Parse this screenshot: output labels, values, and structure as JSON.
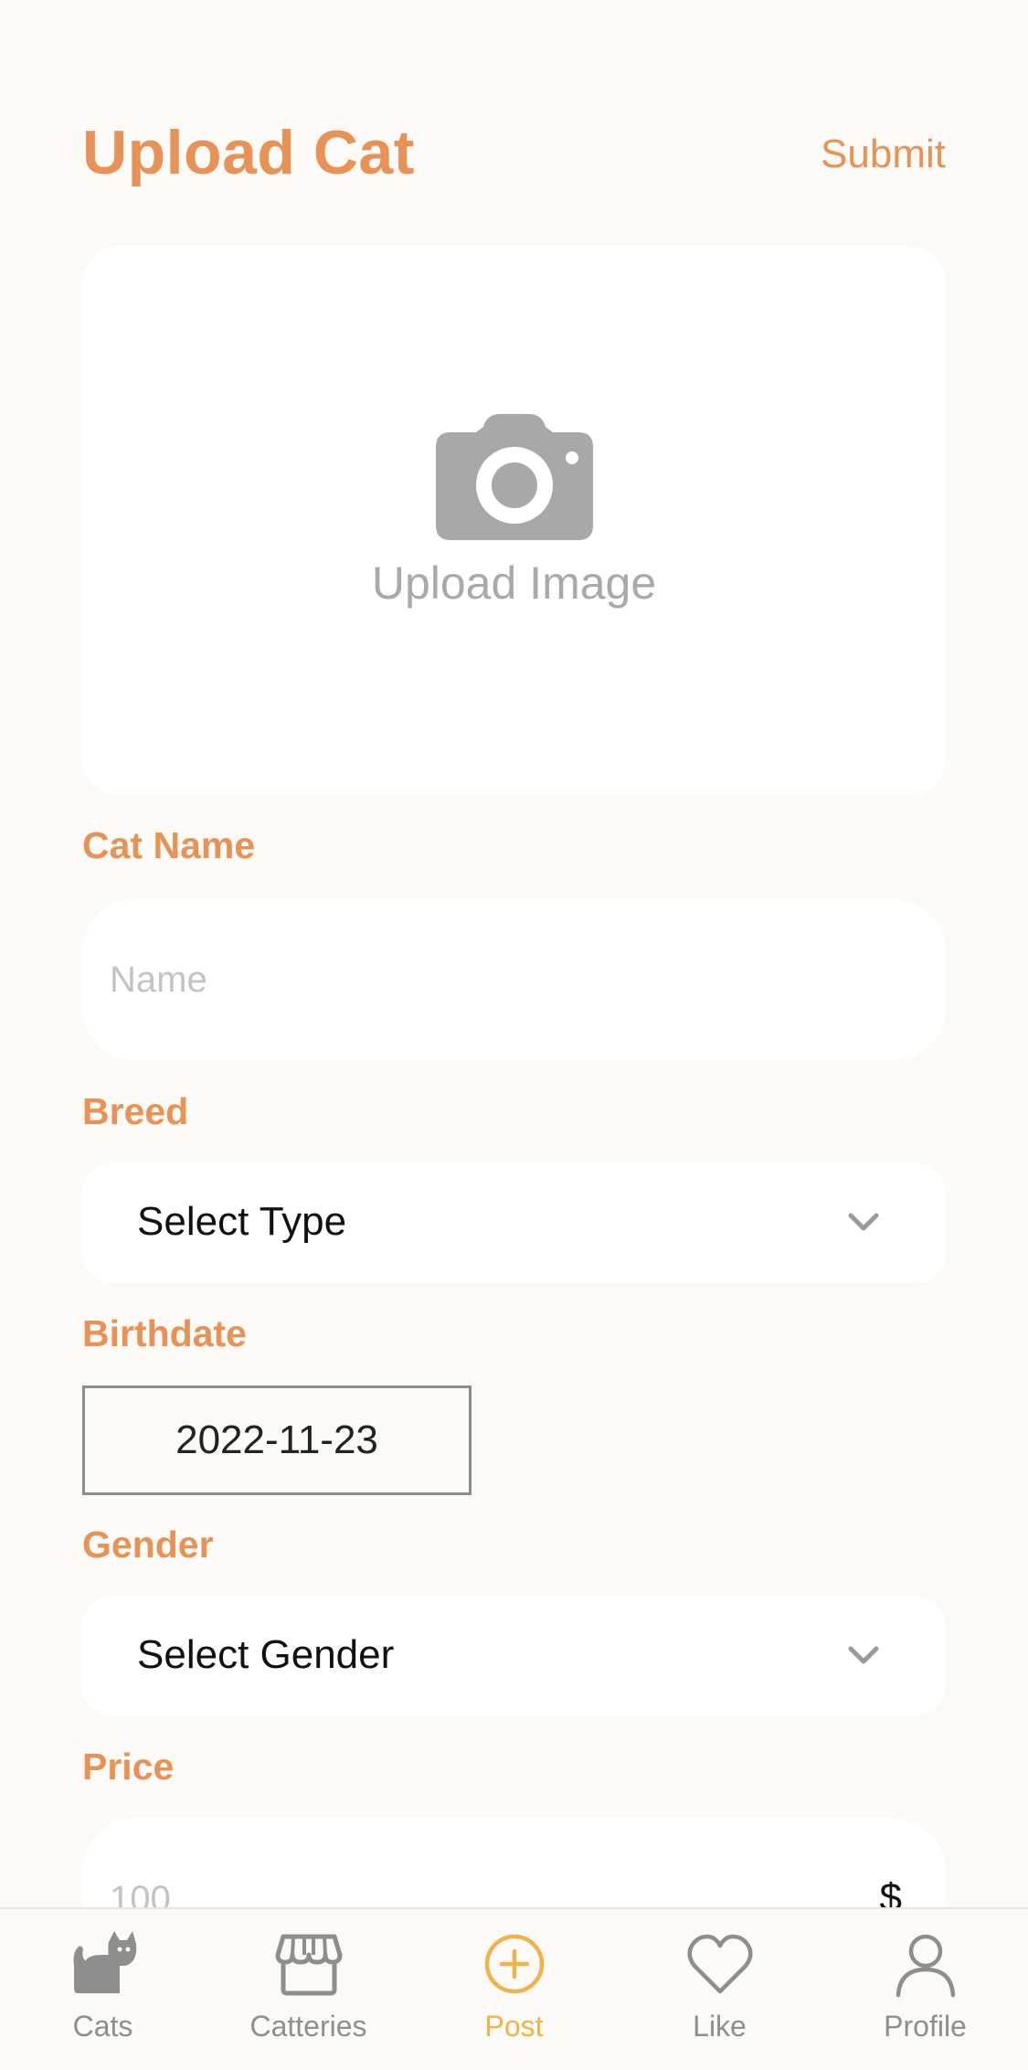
{
  "header": {
    "title": "Upload Cat",
    "submit_label": "Submit"
  },
  "upload": {
    "icon": "camera-icon",
    "label": "Upload Image"
  },
  "form": {
    "name": {
      "label": "Cat Name",
      "placeholder": "Name",
      "value": ""
    },
    "breed": {
      "label": "Breed",
      "selected": "Select Type"
    },
    "birthdate": {
      "label": "Birthdate",
      "value": "2022-11-23"
    },
    "gender": {
      "label": "Gender",
      "selected": "Select Gender"
    },
    "price": {
      "label": "Price",
      "placeholder": "100",
      "currency": "$"
    }
  },
  "tabbar": {
    "active": "Post",
    "active_color": "#f0b24a",
    "items": [
      {
        "label": "Cats",
        "icon": "cat-icon"
      },
      {
        "label": "Catteries",
        "icon": "storefront-icon"
      },
      {
        "label": "Post",
        "icon": "plus-circle-icon"
      },
      {
        "label": "Like",
        "icon": "heart-icon"
      },
      {
        "label": "Profile",
        "icon": "person-icon"
      }
    ]
  },
  "colors": {
    "accent": "#e79256",
    "background": "#fcfaf6",
    "card": "#ffffff",
    "muted": "#a9a9a9"
  }
}
